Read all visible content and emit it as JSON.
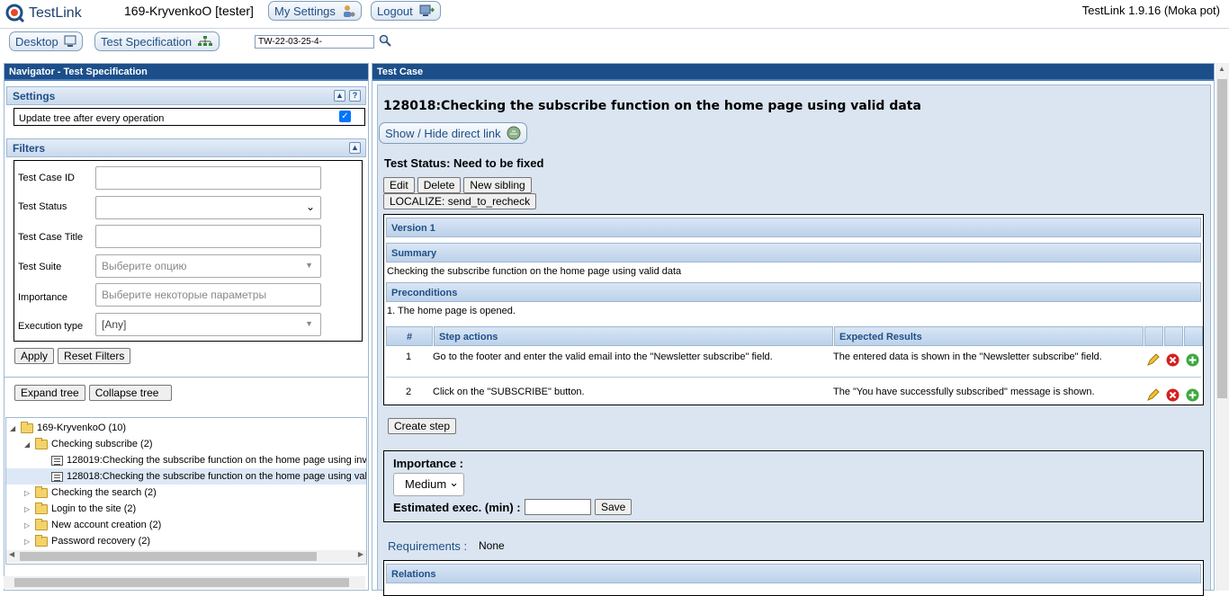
{
  "header": {
    "app_name": "TestLink",
    "user": "169-KryvenkoO [tester]",
    "my_settings": "My Settings",
    "logout": "Logout",
    "version": "TestLink 1.9.16 (Moka pot)"
  },
  "nav": {
    "desktop": "Desktop",
    "test_spec": "Test Specification",
    "search_value": "TW-22-03-25-4-"
  },
  "left": {
    "title": "Navigator - Test Specification",
    "settings_title": "Settings",
    "update_tree_label": "Update tree after every operation",
    "filters_title": "Filters",
    "filters": {
      "tc_id_label": "Test Case ID",
      "status_label": "Test Status",
      "title_label": "Test Case Title",
      "suite_label": "Test Suite",
      "suite_placeholder": "Выберите опцию",
      "importance_label": "Importance",
      "importance_placeholder": "Выберите некоторые параметры",
      "exec_type_label": "Execution type",
      "exec_type_value": "[Any]"
    },
    "apply": "Apply",
    "reset": "Reset Filters",
    "expand": "Expand tree",
    "collapse": "Collapse tree",
    "tree": [
      "169-KryvenkoO (10)",
      "Checking subscribe (2)",
      "128019:Checking the subscribe function on the home page using inv",
      "128018:Checking the subscribe function on the home page using val",
      "Checking the search (2)",
      "Login to the site (2)",
      "New account creation (2)",
      "Password recovery (2)"
    ]
  },
  "right": {
    "title": "Test Case",
    "tc_title": "128018:Checking the subscribe function on the home page using valid data",
    "direct_link": "Show / Hide direct link",
    "status": "Test Status: Need to be fixed",
    "edit": "Edit",
    "delete": "Delete",
    "new_sibling": "New sibling",
    "recheck": "LOCALIZE: send_to_recheck",
    "version": "Version 1",
    "summary_head": "Summary",
    "summary": "Checking the subscribe function on the home page using valid data",
    "preconditions_head": "Preconditions",
    "preconditions": "1. The home page is opened.",
    "steps_cols": [
      "#",
      "Step actions",
      "Expected Results"
    ],
    "steps": [
      {
        "n": "1",
        "action": "Go to the footer and enter the valid email into the \"Newsletter subscribe\" field.",
        "expected": "The entered data is shown in the \"Newsletter subscribe\" field."
      },
      {
        "n": "2",
        "action": "Click on the \"SUBSCRIBE\" button.",
        "expected": "The \"You have successfully subscribed\" message is shown."
      }
    ],
    "create_step": "Create step",
    "importance_label": "Importance :",
    "importance_value": "Medium",
    "est_label": "Estimated exec. (min) :",
    "save": "Save",
    "requirements_label": "Requirements :",
    "requirements_value": "None",
    "relations_head": "Relations"
  }
}
